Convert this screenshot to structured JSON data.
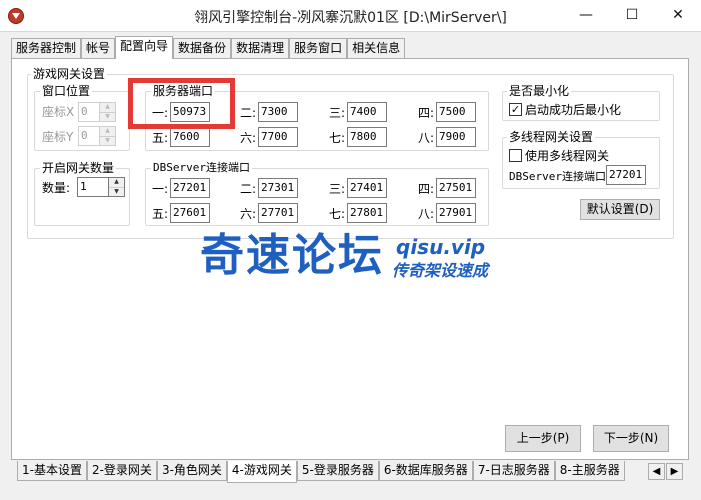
{
  "window": {
    "title": "翎风引擎控制台-冽风寨沉默01区 [D:\\MirServer\\]",
    "minimize": "—",
    "maximize": "☐",
    "close": "✕"
  },
  "tabs": [
    "服务器控制",
    "帐号",
    "配置向导",
    "数据备份",
    "数据清理",
    "服务窗口",
    "相关信息"
  ],
  "gateway": {
    "title": "游戏网关设置",
    "window_pos": {
      "title": "窗口位置",
      "x_label": "座标X",
      "x_value": "0",
      "y_label": "座标Y",
      "y_value": "0"
    },
    "open_count": {
      "title": "开启网关数量",
      "label": "数量:",
      "value": "1"
    },
    "server_ports": {
      "title": "服务器端口",
      "items": [
        {
          "label": "一:",
          "value": "50973"
        },
        {
          "label": "二:",
          "value": "7300"
        },
        {
          "label": "三:",
          "value": "7400"
        },
        {
          "label": "四:",
          "value": "7500"
        },
        {
          "label": "五:",
          "value": "7600"
        },
        {
          "label": "六:",
          "value": "7700"
        },
        {
          "label": "七:",
          "value": "7800"
        },
        {
          "label": "八:",
          "value": "7900"
        }
      ]
    },
    "db_ports": {
      "title": "DBServer连接端口",
      "items": [
        {
          "label": "一:",
          "value": "27201"
        },
        {
          "label": "二:",
          "value": "27301"
        },
        {
          "label": "三:",
          "value": "27401"
        },
        {
          "label": "四:",
          "value": "27501"
        },
        {
          "label": "五:",
          "value": "27601"
        },
        {
          "label": "六:",
          "value": "27701"
        },
        {
          "label": "七:",
          "value": "27801"
        },
        {
          "label": "八:",
          "value": "27901"
        }
      ]
    },
    "minimize": {
      "title": "是否最小化",
      "checkbox_label": "启动成功后最小化",
      "checked": true
    },
    "multithread": {
      "title": "多线程网关设置",
      "checkbox_label": "使用多线程网关",
      "checked": false,
      "db_label": "DBServer连接端口",
      "db_value": "27201"
    },
    "default_button": "默认设置(D)"
  },
  "watermark": {
    "title": "奇速论坛",
    "url": "qisu.vip",
    "slogan": "传奇架设速成"
  },
  "nav": {
    "prev": "上一步(P)",
    "next": "下一步(N)"
  },
  "bottom_tabs": [
    "1-基本设置",
    "2-登录网关",
    "3-角色网关",
    "4-游戏网关",
    "5-登录服务器",
    "6-数据库服务器",
    "7-日志服务器",
    "8-主服务器"
  ],
  "bottom_tabs_active": 3,
  "tabs_active": 2,
  "colors": {
    "highlight": "#e53935",
    "watermark": "#1f5fbf"
  }
}
